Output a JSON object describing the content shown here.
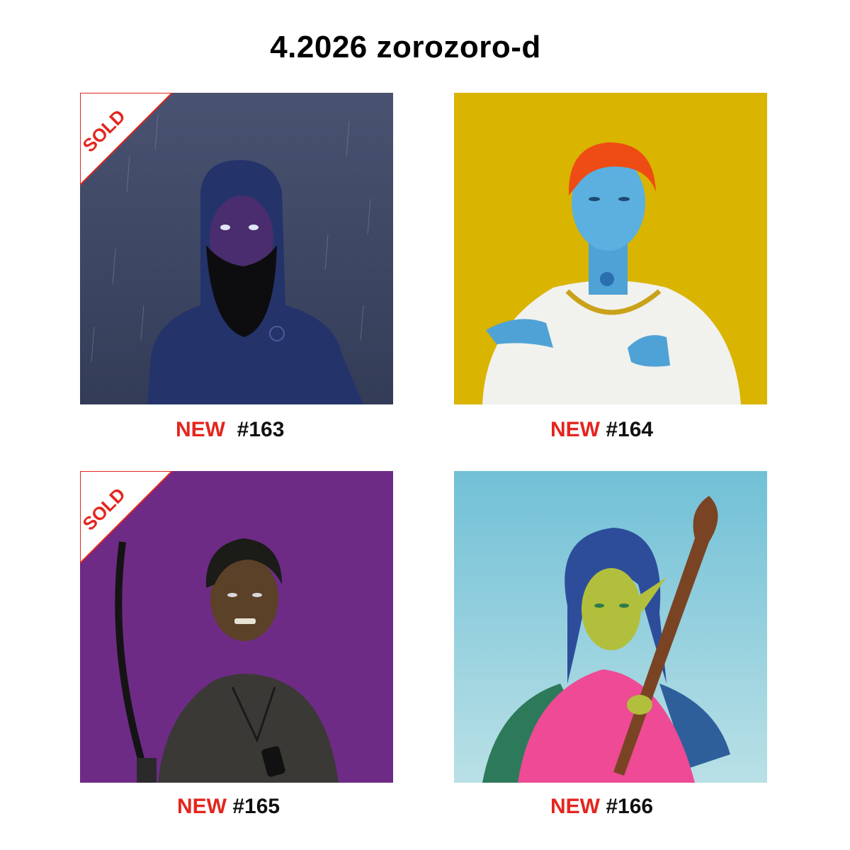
{
  "title": "4.2026 zorozoro-d",
  "colors": {
    "new_label": "#e3261f",
    "sold_badge": "#e3261f",
    "bg_163": "#3d4764",
    "bg_164": "#d9b400",
    "bg_165": "#6e2b86",
    "bg_166": "#79c6d9"
  },
  "artworks": [
    {
      "new_label": "NEW",
      "number": "#163",
      "sold": "SOLD"
    },
    {
      "new_label": "NEW",
      "number": "#164"
    },
    {
      "new_label": "NEW",
      "number": "#165",
      "sold": "SOLD"
    },
    {
      "new_label": "NEW",
      "number": "#166"
    }
  ]
}
